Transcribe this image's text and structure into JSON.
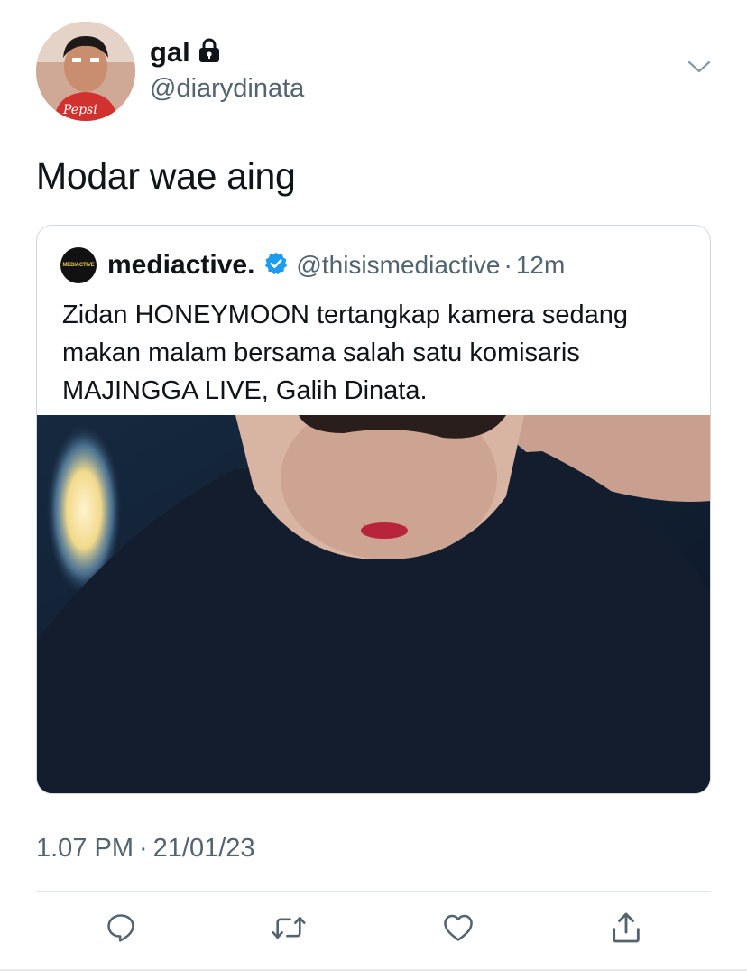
{
  "tweet": {
    "display_name": "gal",
    "handle": "@diarydinata",
    "text": "Modar wae aing",
    "timestamp_time": "1.07 PM",
    "timestamp_sep": "·",
    "timestamp_date": "21/01/23"
  },
  "quote": {
    "avatar_text": "MEDIACTIVE",
    "name": "mediactive.",
    "handle": "@thisismediactive",
    "dot": "·",
    "time": "12m",
    "text": "Zidan HONEYMOON tertangkap kamera sedang makan malam bersama salah satu komisaris MAJINGGA LIVE, Galih Dinata."
  },
  "icons": {
    "lock": "lock-icon",
    "caret": "chevron-down-icon",
    "verified": "verified-badge-icon",
    "reply": "reply-icon",
    "retweet": "retweet-icon",
    "like": "heart-icon",
    "share": "share-icon"
  },
  "colors": {
    "text_primary": "#0f1419",
    "text_secondary": "#536471",
    "verified_blue": "#1d9bf0",
    "border": "#cfd9de"
  }
}
